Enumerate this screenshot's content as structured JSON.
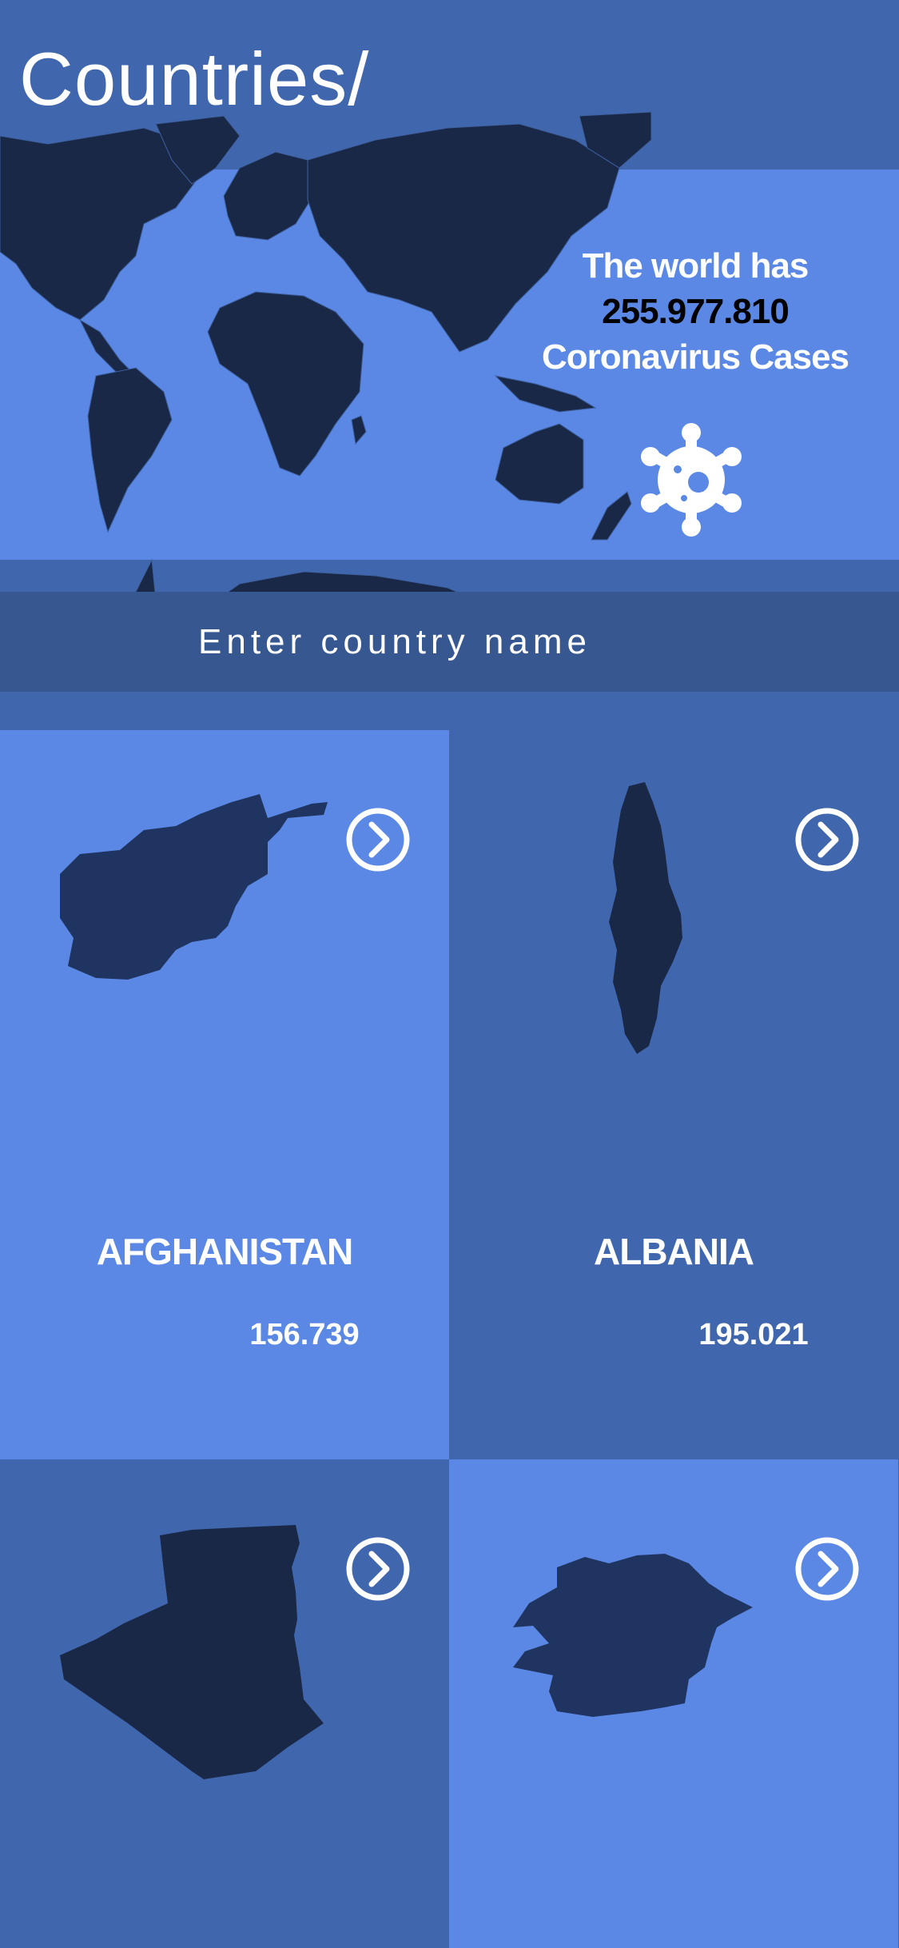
{
  "header": {
    "title": "Countries/"
  },
  "hero": {
    "line1": "The world has",
    "count": "255.977.810",
    "line2": "Coronavirus Cases"
  },
  "search": {
    "placeholder": "Enter country name"
  },
  "countries": [
    {
      "name": "AFGHANISTAN",
      "cases": "156.739"
    },
    {
      "name": "ALBANIA",
      "cases": "195.021"
    },
    {
      "name": "",
      "cases": ""
    },
    {
      "name": "",
      "cases": ""
    }
  ],
  "colors": {
    "primary_blue": "#5a88e4",
    "dark_blue": "#4067ad",
    "search_blue": "#36578f",
    "map_navy": "#1c2a4a",
    "text": "#ffffff"
  },
  "icons": {
    "arrow": "chevron-right-circle-icon",
    "virus": "virus-icon",
    "map": "world-map"
  }
}
